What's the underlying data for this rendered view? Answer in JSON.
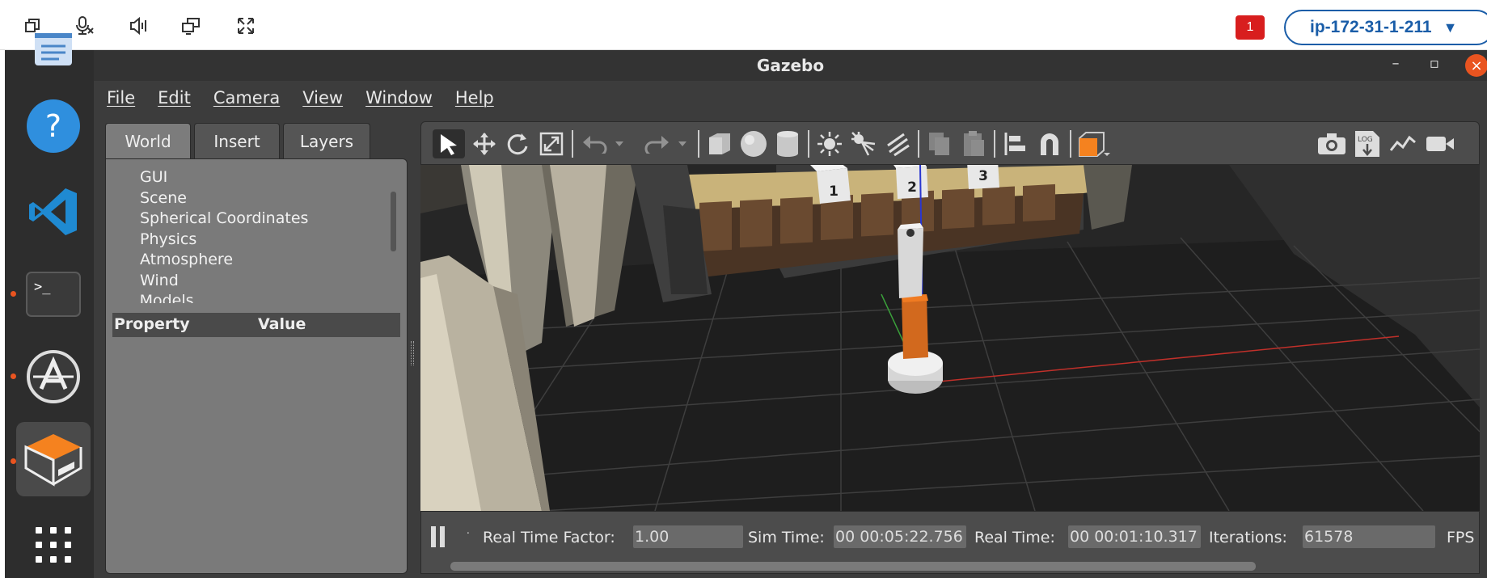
{
  "remote_bar": {
    "icons": [
      "window-restore-icon",
      "mic-off-icon",
      "speaker-icon",
      "monitor-switch-icon",
      "fullscreen-icon"
    ],
    "notification_count": "1",
    "host": "ip-172-31-1-211",
    "host_caret": "▼"
  },
  "dock": {
    "icons": [
      "text-editor-icon",
      "help-icon",
      "vscode-icon",
      "terminal-icon",
      "software-updater-icon",
      "gazebo-icon",
      "app-grid-icon"
    ],
    "help_glyph": "?",
    "terminal_glyph": ">_"
  },
  "window": {
    "title": "Gazebo",
    "minimize": "–",
    "maximize": "▫",
    "close": "×"
  },
  "menu": [
    "File",
    "Edit",
    "Camera",
    "View",
    "Window",
    "Help"
  ],
  "left_panel": {
    "tabs": [
      "World",
      "Insert",
      "Layers"
    ],
    "active_tab": "World",
    "tree_items": [
      "GUI",
      "Scene",
      "Spherical Coordinates",
      "Physics",
      "Atmosphere",
      "Wind",
      "▸ Models"
    ],
    "property_header": "Property",
    "value_header": "Value"
  },
  "toolbar": {
    "tools": [
      "select-icon",
      "translate-icon",
      "rotate-icon",
      "scale-icon",
      "undo-icon",
      "redo-icon",
      "box-icon",
      "sphere-icon",
      "cylinder-icon",
      "point-light-icon",
      "spot-light-icon",
      "directional-light-icon",
      "copy-icon",
      "paste-icon",
      "align-icon",
      "snap-icon",
      "view-angle-icon",
      "screenshot-icon",
      "log-icon",
      "plot-icon",
      "record-icon"
    ],
    "log_text": "LOG"
  },
  "scene": {
    "box_labels": [
      "1",
      "2",
      "3"
    ],
    "colors": {
      "robot_orange": "#d2691e",
      "floor": "#1e1e1e",
      "counter": "#c9b37a",
      "cabinet": "#4a3424",
      "x_axis": "#c0302a",
      "y_axis": "#3aa03a",
      "z_axis": "#2a36d0"
    }
  },
  "status": {
    "real_time_factor_label": "Real Time Factor:",
    "real_time_factor": "1.00",
    "sim_time_label": "Sim Time:",
    "sim_time": "00 00:05:22.756",
    "real_time_label": "Real Time:",
    "real_time": "00 00:01:10.317",
    "iterations_label": "Iterations:",
    "iterations": "61578",
    "fps_label": "FPS"
  }
}
